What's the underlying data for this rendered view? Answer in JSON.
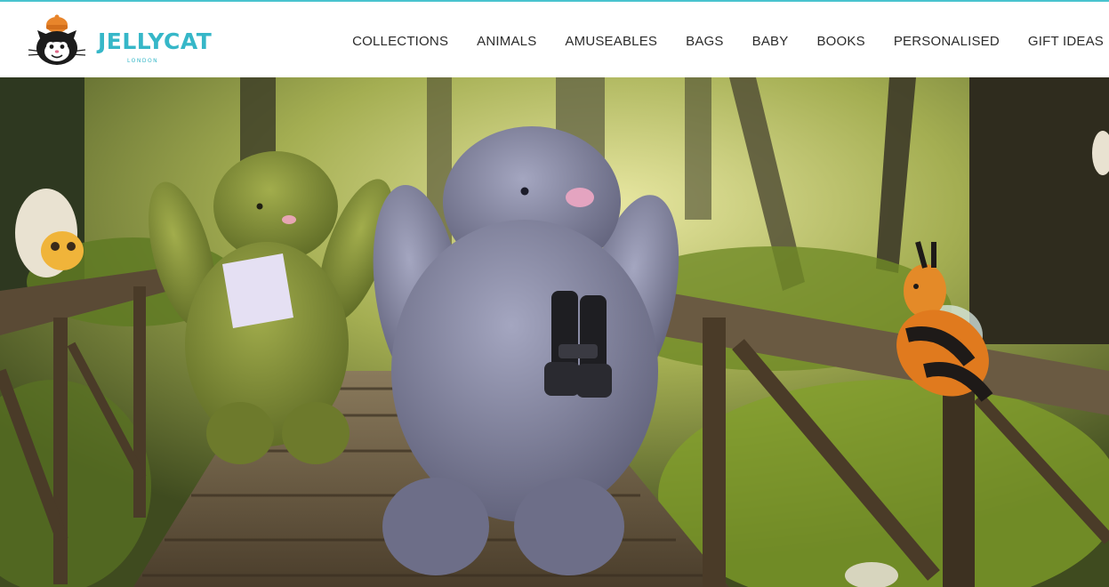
{
  "brand": {
    "name": "JELLYCAT",
    "tagline": "LONDON",
    "accent": "#36b7c8",
    "border": "#49c3cf"
  },
  "nav": {
    "items": [
      {
        "label": "COLLECTIONS"
      },
      {
        "label": "ANIMALS"
      },
      {
        "label": "AMUSEABLES"
      },
      {
        "label": "BAGS"
      },
      {
        "label": "BABY"
      },
      {
        "label": "BOOKS"
      },
      {
        "label": "PERSONALISED"
      },
      {
        "label": "GIFT IDEAS"
      }
    ]
  },
  "hero": {
    "scene": "woodland-bridge",
    "characters": [
      "moss-green-bunny-icon",
      "lavender-bunny-icon",
      "bumblebee-icon",
      "egg-toy-icon"
    ],
    "colors": {
      "forest": "#7a8f3a",
      "bridge": "#5a4a35",
      "lavender_bunny": "#7d7f99",
      "green_bunny": "#7c8a35",
      "bee_orange": "#e07a1e",
      "bee_black": "#1e1a18"
    }
  }
}
